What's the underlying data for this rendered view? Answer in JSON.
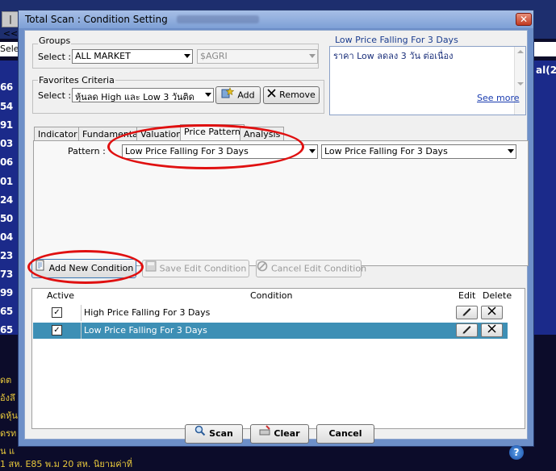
{
  "background": {
    "nav_glyph": "|<<",
    "header_left": "Sele",
    "left_numbers": [
      "66",
      "54",
      "91",
      "03",
      "06",
      "01",
      "24",
      "50",
      "04",
      "23",
      "73",
      "99",
      "65",
      "65"
    ],
    "right_text": "al(2",
    "footer_lines": [
      "ดต",
      "อ้งลึ",
      "ดหุ้น",
      "ดรท",
      "น แ",
      "1 สห. E85 พ.ม 20 สห. นิยามค่าที่"
    ]
  },
  "dialog": {
    "title": "Total Scan : Condition Setting",
    "close_glyph": "✕"
  },
  "groups": {
    "label": "Groups",
    "select_label": "Select :",
    "market_value": "ALL MARKET",
    "sector_value": "$AGRI"
  },
  "favorites": {
    "label": "Favorites Criteria",
    "select_label": "Select :",
    "value": "หุ้นลด High และ Low 3 วันติด",
    "add_label": "Add",
    "remove_label": "Remove"
  },
  "description": {
    "title": "Low Price Falling For 3 Days",
    "text": "ราคา Low ลดลง 3 วัน ต่อเนื่อง",
    "see_more": "See more"
  },
  "tabs": [
    {
      "label": "Indicator"
    },
    {
      "label": "Fundamental"
    },
    {
      "label": "Valuation"
    },
    {
      "label": "Price Pattern"
    },
    {
      "label": "Analysis"
    }
  ],
  "pattern": {
    "label": "Pattern :",
    "value1": "Low Price Falling For 3 Days",
    "value2": "Low Price Falling For 3 Days"
  },
  "actions": {
    "add_new": "Add New Condition",
    "save_edit": "Save Edit Condition",
    "cancel_edit": "Cancel Edit Condition"
  },
  "table": {
    "headers": {
      "active": "Active",
      "condition": "Condition",
      "edit": "Edit",
      "delete": "Delete"
    },
    "rows": [
      {
        "active": "✓",
        "condition": "High Price Falling For 3 Days"
      },
      {
        "active": "✓",
        "condition": "Low Price Falling For 3 Days"
      }
    ]
  },
  "footer": {
    "scan": "Scan",
    "clear": "Clear",
    "cancel": "Cancel",
    "help": "?"
  },
  "colors": {
    "selected_row": "#3d8fb5",
    "annotation": "#e01010",
    "dialog_frame": "#6d8fc8"
  }
}
